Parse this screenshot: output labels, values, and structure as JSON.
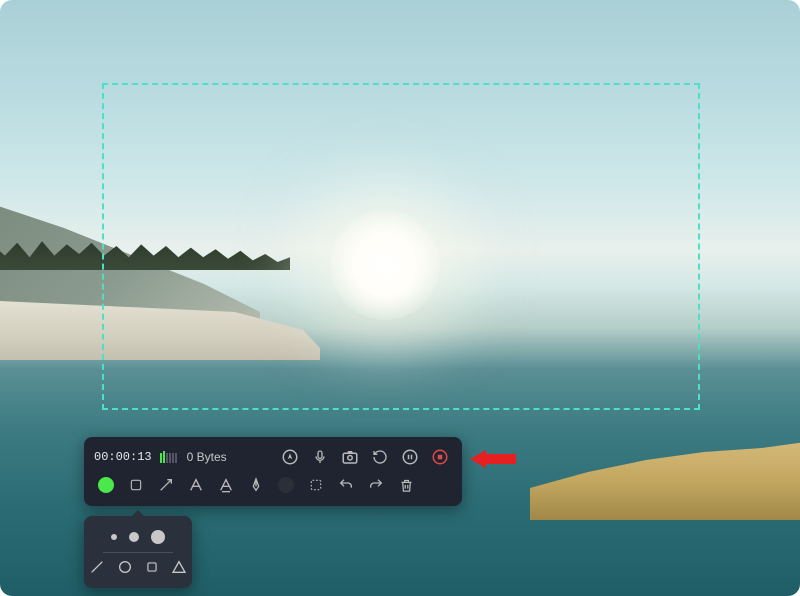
{
  "recorder": {
    "timer": "00:00:13",
    "filesize": "0 Bytes",
    "level_bars_active": 2,
    "level_bars_total": 6
  },
  "colors": {
    "capture_border": "#4de0c8",
    "stop_accent": "#e04848",
    "green": "#4ae84a",
    "arrow_red": "#e62020"
  },
  "tools": {
    "top": [
      "cursor-highlight",
      "microphone",
      "camera",
      "refresh",
      "pause",
      "stop"
    ],
    "bottom": [
      "color-green",
      "rectangle",
      "arrow",
      "text",
      "highlighter",
      "pen",
      "color-dark",
      "selection",
      "undo",
      "redo",
      "delete"
    ]
  },
  "popup": {
    "sizes": [
      "small",
      "medium",
      "large"
    ],
    "shapes": [
      "line",
      "circle",
      "square",
      "triangle"
    ]
  }
}
